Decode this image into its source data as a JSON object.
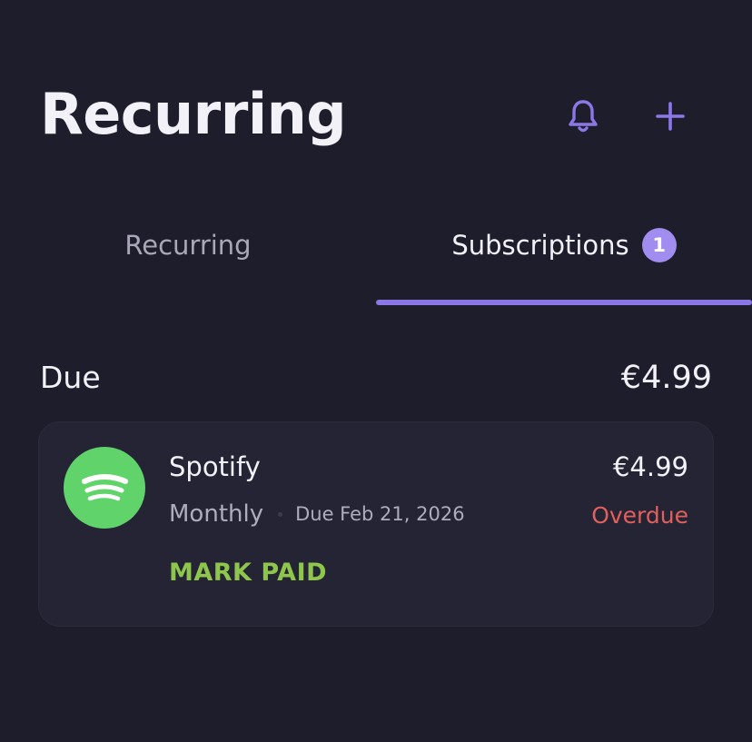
{
  "header": {
    "title": "Recurring",
    "bell_icon": "bell-icon",
    "add_icon": "plus-icon"
  },
  "tabs": [
    {
      "label": "Recurring",
      "active": false
    },
    {
      "label": "Subscriptions",
      "active": true,
      "badge": "1"
    }
  ],
  "section": {
    "title": "Due",
    "total": "€4.99"
  },
  "subscriptions": [
    {
      "name": "Spotify",
      "logo_icon": "spotify-logo-icon",
      "frequency": "Monthly",
      "due": "Due Feb 21, 2026",
      "amount": "€4.99",
      "status": "Overdue",
      "action_label": "MARK PAID"
    }
  ],
  "colors": {
    "background": "#1e1d2b",
    "card": "#252434",
    "accent": "#8b78e6",
    "badge": "#a18cf0",
    "overdue": "#e0605d",
    "action": "#8ec54c",
    "spotify": "#61d36b"
  }
}
